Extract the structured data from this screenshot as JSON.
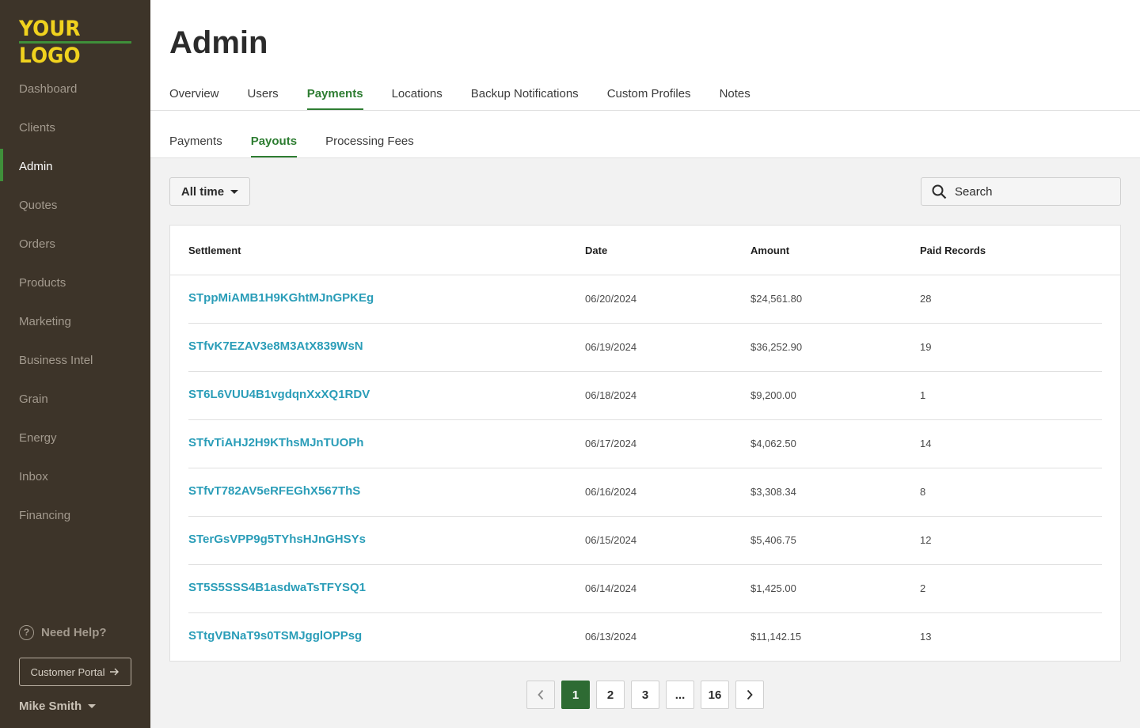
{
  "sidebar": {
    "logo_text": "YOUR LOGO",
    "nav_items": [
      {
        "label": "Dashboard"
      },
      {
        "label": "Clients"
      },
      {
        "label": "Admin",
        "active": true
      },
      {
        "label": "Quotes"
      },
      {
        "label": "Orders"
      },
      {
        "label": "Products"
      },
      {
        "label": "Marketing"
      },
      {
        "label": "Business Intel"
      },
      {
        "label": "Grain"
      },
      {
        "label": "Energy"
      },
      {
        "label": "Inbox"
      },
      {
        "label": "Financing"
      }
    ],
    "help_label": "Need Help?",
    "portal_label": "Customer Portal",
    "user_name": "Mike Smith"
  },
  "header": {
    "title": "Admin",
    "tabs": [
      "Overview",
      "Users",
      "Payments",
      "Locations",
      "Backup Notifications",
      "Custom Profiles",
      "Notes"
    ],
    "active_tab": "Payments",
    "subtabs": [
      "Payments",
      "Payouts",
      "Processing Fees"
    ],
    "active_subtab": "Payouts"
  },
  "toolbar": {
    "filter_label": "All time",
    "search_placeholder": "Search"
  },
  "table": {
    "columns": [
      "Settlement",
      "Date",
      "Amount",
      "Paid Records"
    ],
    "rows": [
      [
        "STppMiAMB1H9KGhtMJnGPKEg",
        "06/20/2024",
        "$24,561.80",
        "28"
      ],
      [
        "STfvK7EZAV3e8M3AtX839WsN",
        "06/19/2024",
        "$36,252.90",
        "19"
      ],
      [
        "ST6L6VUU4B1vgdqnXxXQ1RDV",
        "06/18/2024",
        "$9,200.00",
        "1"
      ],
      [
        "STfvTiAHJ2H9KThsMJnTUOPh",
        "06/17/2024",
        "$4,062.50",
        "14"
      ],
      [
        "STfvT782AV5eRFEGhX567ThS",
        "06/16/2024",
        "$3,308.34",
        "8"
      ],
      [
        "STerGsVPP9g5TYhsHJnGHSYs",
        "06/15/2024",
        "$5,406.75",
        "12"
      ],
      [
        "ST5S5SSS4B1asdwaTsTFYSQ1",
        "06/14/2024",
        "$1,425.00",
        "2"
      ],
      [
        "STtgVBNaT9s0TSMJgglOPPsg",
        "06/13/2024",
        "$11,142.15",
        "13"
      ]
    ]
  },
  "pagination": {
    "pages": [
      "1",
      "2",
      "3",
      "...",
      "16"
    ],
    "current": "1"
  },
  "colors": {
    "sidebar_bg": "#3d3429",
    "logo": "#f0d21e",
    "accent_green": "#2e7d32",
    "link_blue": "#2a9db8"
  }
}
